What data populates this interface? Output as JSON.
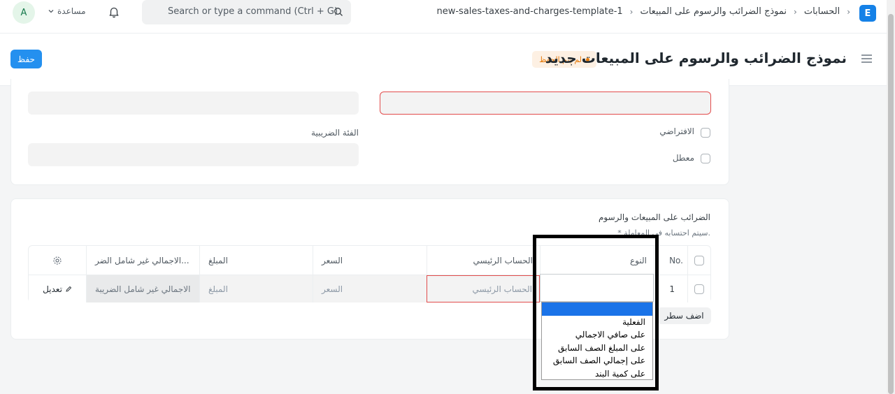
{
  "navbar": {
    "avatar_initial": "A",
    "help_label": "مساعدة",
    "search_placeholder": "Search or type a command (Ctrl + G)",
    "breadcrumbs": [
      "الحسابات",
      "نموذج الضرائب والرسوم على المبيعات",
      "new-sales-taxes-and-charges-template-1"
    ],
    "logo_letter": "E"
  },
  "page": {
    "title": "نموذج الضرائب والرسوم على المبيعات جديد",
    "status": "لم يتم الحفظ",
    "save_label": "حفظ"
  },
  "form": {
    "default_label": "الافتراضي",
    "disabled_label": "معطل",
    "tax_category_label": "الفئة الضريبية"
  },
  "taxes_section": {
    "title": "الضرائب على المبيعات والرسوم",
    "note": "* سيتم احتسابه في المعاملة.",
    "columns": {
      "no": "No.",
      "type": "النوع",
      "account_head": "الحساب الرئيسي",
      "rate": "السعر",
      "amount": "المبلغ",
      "total": "الاجمالي غير شامل الضر..."
    },
    "row": {
      "index": "1",
      "account_head": "الحساب الرئيسي",
      "rate": "السعر",
      "amount": "المبلغ",
      "total": "الاجمالي غير شامل الضريبة",
      "edit_label": "تعديل"
    },
    "add_row_label": "اضف سطر"
  },
  "type_dropdown": {
    "options": [
      "",
      "الفعلية",
      "على صافي الاجمالي",
      "على المبلغ الصف السابق",
      "على إجمالي الصف السابق",
      "على كمية البند"
    ],
    "selected_index": 0
  },
  "colors": {
    "primary": "#2490ef",
    "status_orange": "#e57a0b",
    "error_red": "#e24c4c",
    "dropdown_selected": "#1a73e8"
  }
}
